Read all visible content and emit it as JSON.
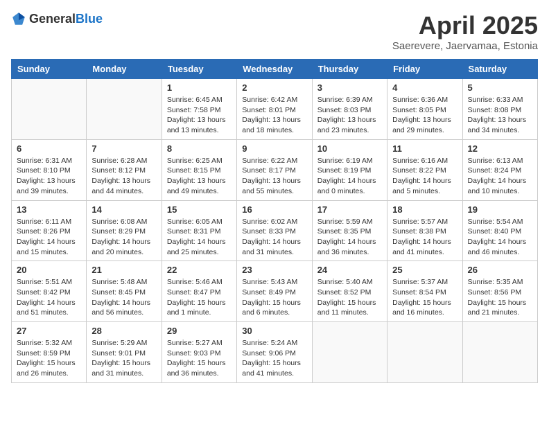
{
  "logo": {
    "text_general": "General",
    "text_blue": "Blue"
  },
  "title": "April 2025",
  "location": "Saerevere, Jaervamaa, Estonia",
  "weekdays": [
    "Sunday",
    "Monday",
    "Tuesday",
    "Wednesday",
    "Thursday",
    "Friday",
    "Saturday"
  ],
  "weeks": [
    [
      {
        "day": "",
        "info": ""
      },
      {
        "day": "",
        "info": ""
      },
      {
        "day": "1",
        "info": "Sunrise: 6:45 AM\nSunset: 7:58 PM\nDaylight: 13 hours and 13 minutes."
      },
      {
        "day": "2",
        "info": "Sunrise: 6:42 AM\nSunset: 8:01 PM\nDaylight: 13 hours and 18 minutes."
      },
      {
        "day": "3",
        "info": "Sunrise: 6:39 AM\nSunset: 8:03 PM\nDaylight: 13 hours and 23 minutes."
      },
      {
        "day": "4",
        "info": "Sunrise: 6:36 AM\nSunset: 8:05 PM\nDaylight: 13 hours and 29 minutes."
      },
      {
        "day": "5",
        "info": "Sunrise: 6:33 AM\nSunset: 8:08 PM\nDaylight: 13 hours and 34 minutes."
      }
    ],
    [
      {
        "day": "6",
        "info": "Sunrise: 6:31 AM\nSunset: 8:10 PM\nDaylight: 13 hours and 39 minutes."
      },
      {
        "day": "7",
        "info": "Sunrise: 6:28 AM\nSunset: 8:12 PM\nDaylight: 13 hours and 44 minutes."
      },
      {
        "day": "8",
        "info": "Sunrise: 6:25 AM\nSunset: 8:15 PM\nDaylight: 13 hours and 49 minutes."
      },
      {
        "day": "9",
        "info": "Sunrise: 6:22 AM\nSunset: 8:17 PM\nDaylight: 13 hours and 55 minutes."
      },
      {
        "day": "10",
        "info": "Sunrise: 6:19 AM\nSunset: 8:19 PM\nDaylight: 14 hours and 0 minutes."
      },
      {
        "day": "11",
        "info": "Sunrise: 6:16 AM\nSunset: 8:22 PM\nDaylight: 14 hours and 5 minutes."
      },
      {
        "day": "12",
        "info": "Sunrise: 6:13 AM\nSunset: 8:24 PM\nDaylight: 14 hours and 10 minutes."
      }
    ],
    [
      {
        "day": "13",
        "info": "Sunrise: 6:11 AM\nSunset: 8:26 PM\nDaylight: 14 hours and 15 minutes."
      },
      {
        "day": "14",
        "info": "Sunrise: 6:08 AM\nSunset: 8:29 PM\nDaylight: 14 hours and 20 minutes."
      },
      {
        "day": "15",
        "info": "Sunrise: 6:05 AM\nSunset: 8:31 PM\nDaylight: 14 hours and 25 minutes."
      },
      {
        "day": "16",
        "info": "Sunrise: 6:02 AM\nSunset: 8:33 PM\nDaylight: 14 hours and 31 minutes."
      },
      {
        "day": "17",
        "info": "Sunrise: 5:59 AM\nSunset: 8:35 PM\nDaylight: 14 hours and 36 minutes."
      },
      {
        "day": "18",
        "info": "Sunrise: 5:57 AM\nSunset: 8:38 PM\nDaylight: 14 hours and 41 minutes."
      },
      {
        "day": "19",
        "info": "Sunrise: 5:54 AM\nSunset: 8:40 PM\nDaylight: 14 hours and 46 minutes."
      }
    ],
    [
      {
        "day": "20",
        "info": "Sunrise: 5:51 AM\nSunset: 8:42 PM\nDaylight: 14 hours and 51 minutes."
      },
      {
        "day": "21",
        "info": "Sunrise: 5:48 AM\nSunset: 8:45 PM\nDaylight: 14 hours and 56 minutes."
      },
      {
        "day": "22",
        "info": "Sunrise: 5:46 AM\nSunset: 8:47 PM\nDaylight: 15 hours and 1 minute."
      },
      {
        "day": "23",
        "info": "Sunrise: 5:43 AM\nSunset: 8:49 PM\nDaylight: 15 hours and 6 minutes."
      },
      {
        "day": "24",
        "info": "Sunrise: 5:40 AM\nSunset: 8:52 PM\nDaylight: 15 hours and 11 minutes."
      },
      {
        "day": "25",
        "info": "Sunrise: 5:37 AM\nSunset: 8:54 PM\nDaylight: 15 hours and 16 minutes."
      },
      {
        "day": "26",
        "info": "Sunrise: 5:35 AM\nSunset: 8:56 PM\nDaylight: 15 hours and 21 minutes."
      }
    ],
    [
      {
        "day": "27",
        "info": "Sunrise: 5:32 AM\nSunset: 8:59 PM\nDaylight: 15 hours and 26 minutes."
      },
      {
        "day": "28",
        "info": "Sunrise: 5:29 AM\nSunset: 9:01 PM\nDaylight: 15 hours and 31 minutes."
      },
      {
        "day": "29",
        "info": "Sunrise: 5:27 AM\nSunset: 9:03 PM\nDaylight: 15 hours and 36 minutes."
      },
      {
        "day": "30",
        "info": "Sunrise: 5:24 AM\nSunset: 9:06 PM\nDaylight: 15 hours and 41 minutes."
      },
      {
        "day": "",
        "info": ""
      },
      {
        "day": "",
        "info": ""
      },
      {
        "day": "",
        "info": ""
      }
    ]
  ]
}
